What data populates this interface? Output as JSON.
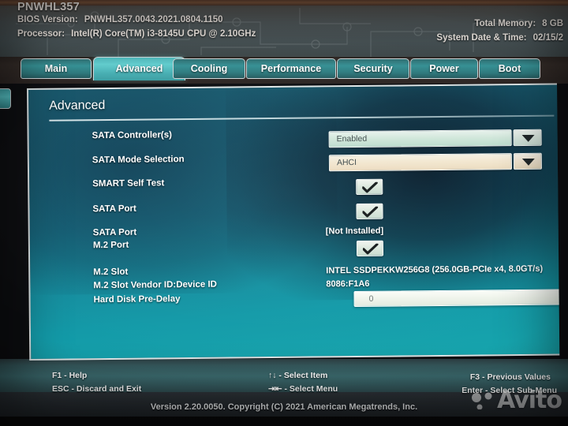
{
  "header": {
    "model": "PNWHL357",
    "bios_version_label": "BIOS Version:",
    "bios_version_value": "PNWHL357.0043.2021.0804.1150",
    "processor_label": "Processor:",
    "processor_value": "Intel(R) Core(TM) i3-8145U CPU @ 2.10GHz",
    "total_memory_label": "Total Memory:",
    "total_memory_value": "8 GB",
    "datetime_label": "System Date & Time:",
    "datetime_value": "02/15/2"
  },
  "tabs": [
    {
      "label": "Main",
      "active": false
    },
    {
      "label": "Advanced",
      "active": true
    },
    {
      "label": "Cooling",
      "active": false
    },
    {
      "label": "Performance",
      "active": false
    },
    {
      "label": "Security",
      "active": false
    },
    {
      "label": "Power",
      "active": false
    },
    {
      "label": "Boot",
      "active": false
    }
  ],
  "panel": {
    "title": "Advanced",
    "rows": [
      {
        "label": "SATA Controller(s)",
        "control": "dropdown",
        "value": "Enabled"
      },
      {
        "label": "SATA Mode Selection",
        "control": "dropdown",
        "value": "AHCI"
      },
      {
        "label": "SMART Self Test",
        "control": "checkbox",
        "value": "checked"
      },
      {
        "label": "SATA Port",
        "control": "checkbox",
        "value": "checked"
      },
      {
        "label": "SATA Port",
        "control": "text",
        "value": "[Not Installed]"
      },
      {
        "label": "M.2 Port",
        "control": "checkbox",
        "value": "checked"
      },
      {
        "label": "M.2 Slot",
        "control": "text",
        "value": "INTEL SSDPEKKW256G8 (256.0GB-PCIe x4, 8.0GT/s)"
      },
      {
        "label": "M.2 Slot Vendor ID:Device ID",
        "control": "text",
        "value": "8086:F1A6"
      },
      {
        "label": "Hard Disk Pre-Delay",
        "control": "input",
        "value": "0"
      }
    ]
  },
  "footer": {
    "help": "F1 - Help",
    "discard": "ESC - Discard and Exit",
    "select_item": "↑↓ - Select Item",
    "select_menu": "⇥⇤ - Select Menu",
    "previous_values": "F3 - Previous Values",
    "select_submenu": "Enter - Select Sub-Menu",
    "version": "Version 2.20.0050. Copyright (C) 2021 American Megatrends, Inc."
  },
  "watermark": {
    "text": "Avito"
  },
  "colors": {
    "panel_teal": "#17798f",
    "tab_active": "#4fb9bc",
    "tab_inactive": "#359195",
    "header_gray": "#4c5456",
    "field_light": "#e7f2ec"
  }
}
